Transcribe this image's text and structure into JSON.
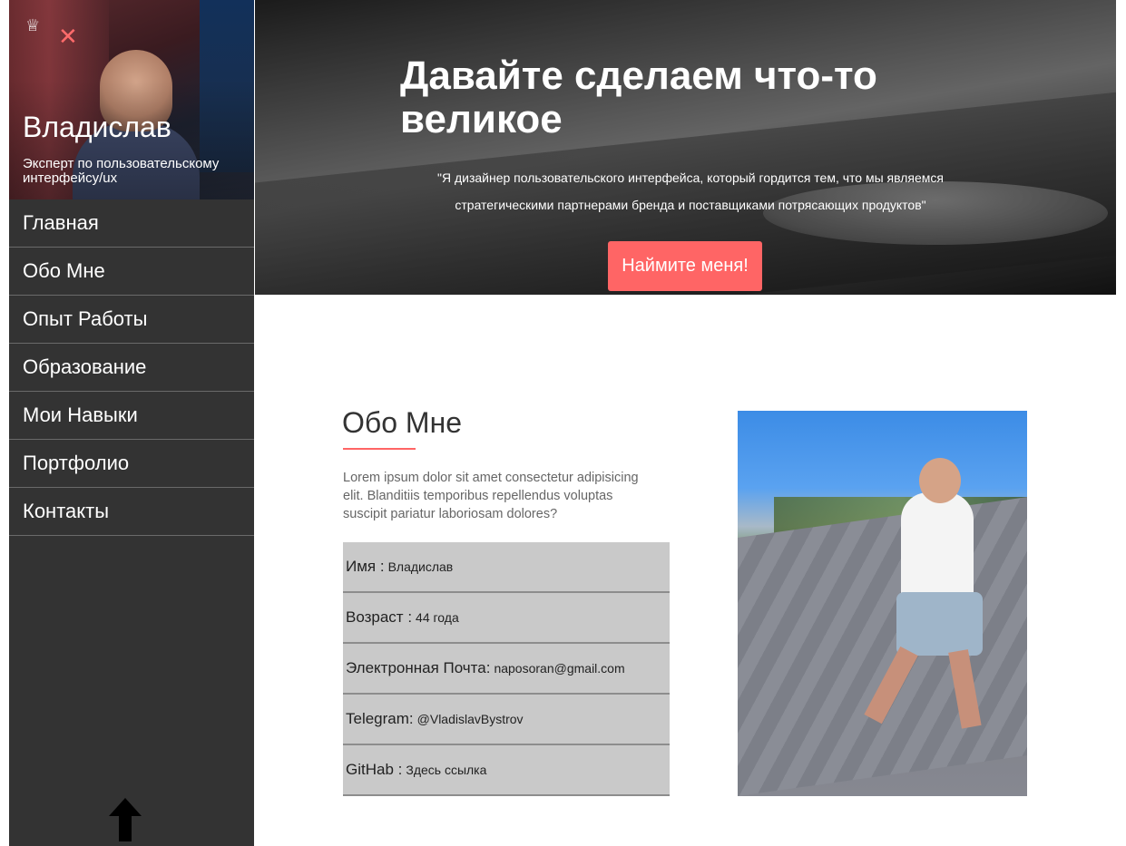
{
  "sidebar": {
    "logo_glyph": "♕",
    "close_glyph": "✕",
    "name": "Владислав",
    "role": "Эксперт по пользовательскому интерфейсу/ux",
    "nav": [
      {
        "label": "Главная"
      },
      {
        "label": "Обо Мне"
      },
      {
        "label": "Опыт Работы"
      },
      {
        "label": "Образование"
      },
      {
        "label": "Мои Навыки"
      },
      {
        "label": "Портфолио"
      },
      {
        "label": "Контакты"
      }
    ],
    "icons": {
      "logo": "crown-icon",
      "close": "close-icon",
      "scroll_up": "arrow-up-icon"
    }
  },
  "hero": {
    "title": "Давайте сделаем что-то великое",
    "quote": "\"Я дизайнер пользовательского интерфейса, который гордится тем, что мы являемся стратегическими партнерами бренда и поставщиками потрясающих продуктов\"",
    "button": "Наймите меня!"
  },
  "about": {
    "title": "Обо Мне",
    "text": "Lorem ipsum dolor sit amet consectetur adipisicing elit. Blanditiis temporibus repellendus voluptas suscipit pariatur laboriosam dolores?",
    "info": [
      {
        "key": "Имя :",
        "value": "Владислав"
      },
      {
        "key": "Возраст :",
        "value": "44 года"
      },
      {
        "key": "Электронная Почта:",
        "value": "naposoran@gmail.com"
      },
      {
        "key": "Telegram:",
        "value": "@VladislavBystrov"
      },
      {
        "key": "GitHab :",
        "value": "Здесь ссылка"
      }
    ]
  },
  "colors": {
    "accent": "#ff6565",
    "sidebar": "#333333",
    "info_bg": "#c9c9c9"
  }
}
